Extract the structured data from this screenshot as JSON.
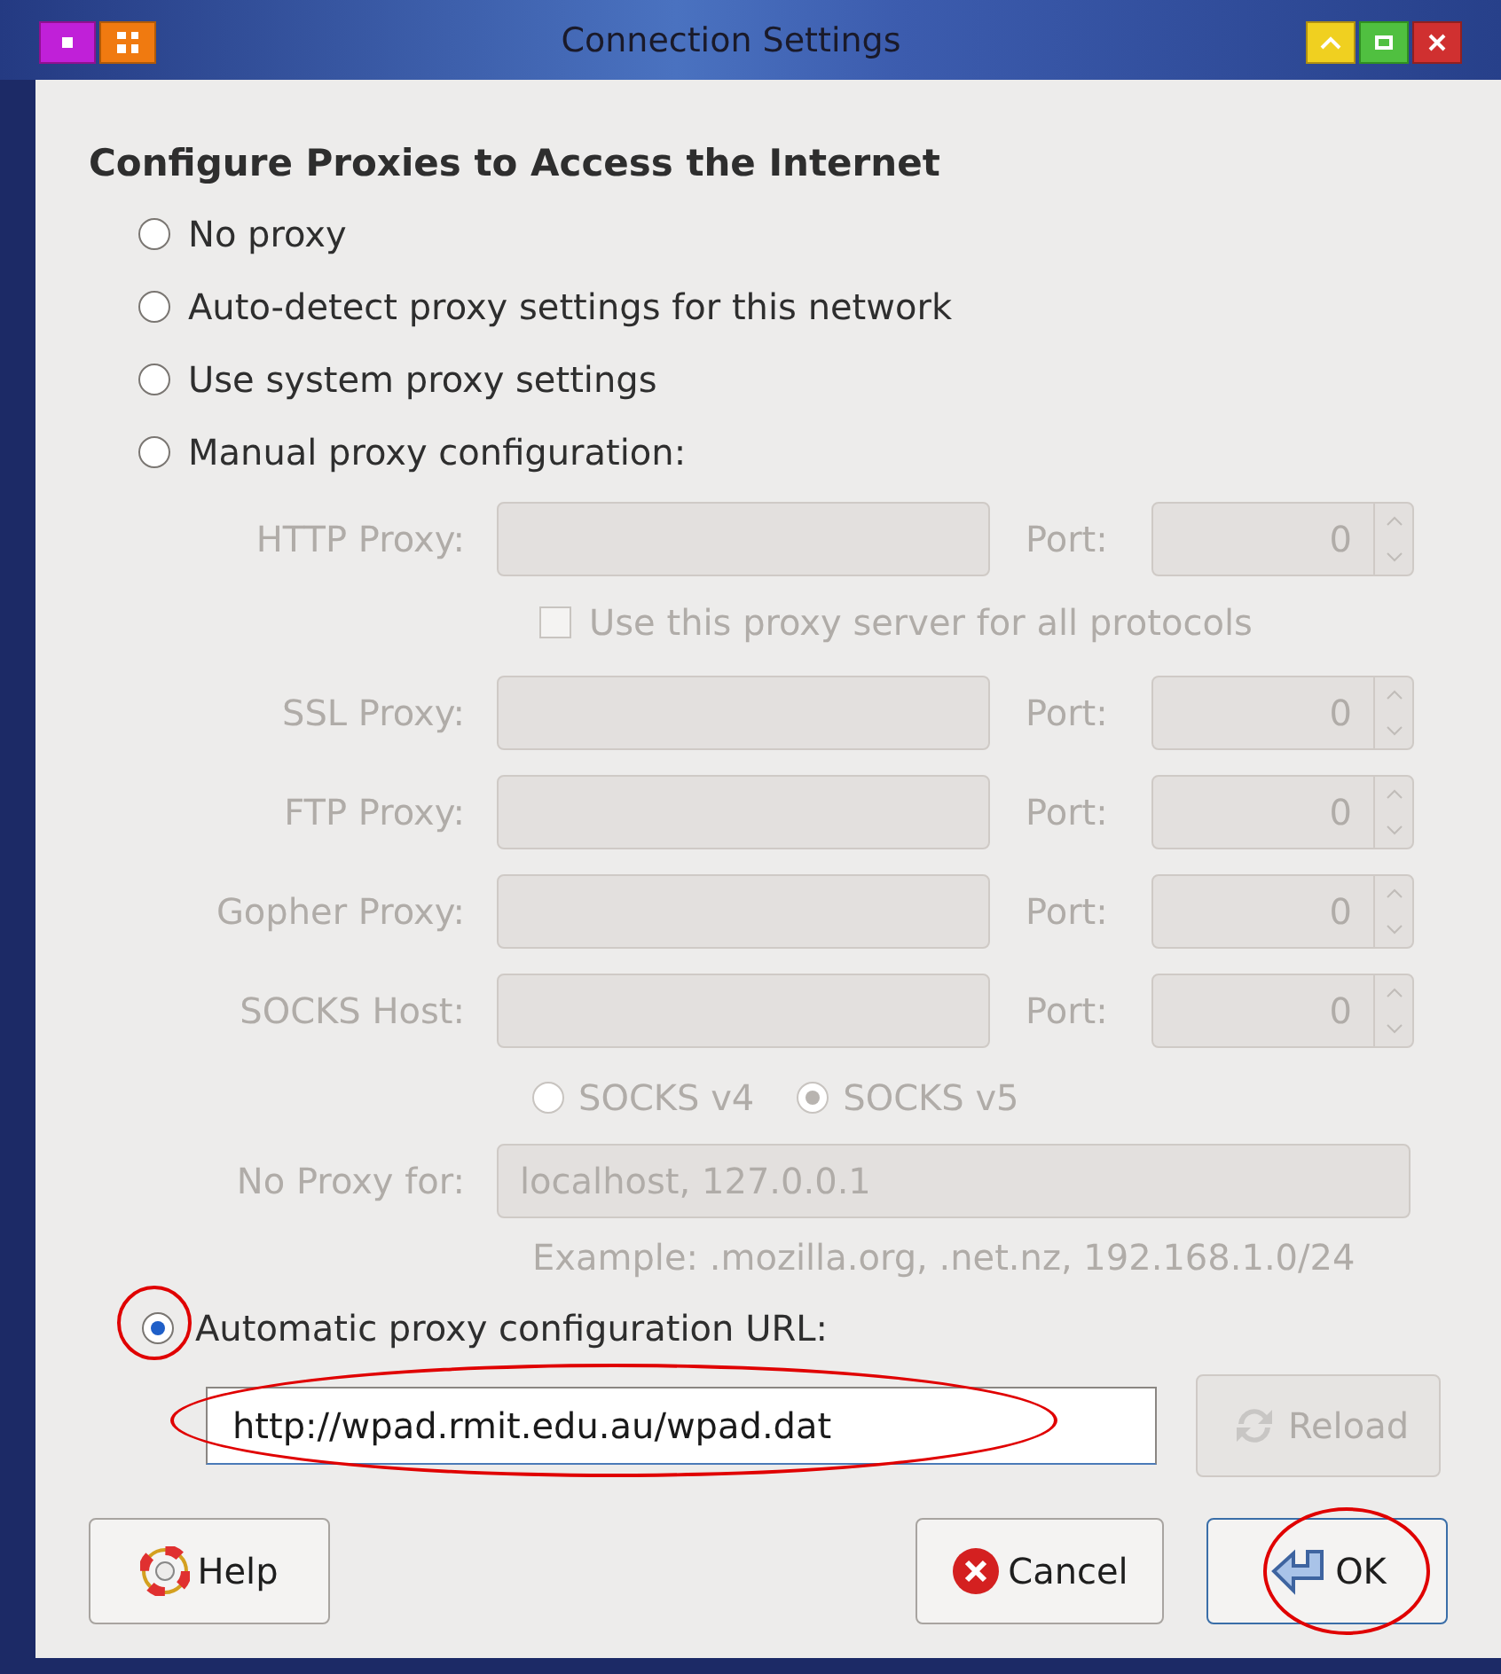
{
  "window": {
    "title": "Connection Settings"
  },
  "heading": "Configure Proxies to Access the Internet",
  "modes": [
    {
      "label": "No proxy",
      "selected": false
    },
    {
      "label": "Auto-detect proxy settings for this network",
      "selected": false
    },
    {
      "label": "Use system proxy settings",
      "selected": false
    },
    {
      "label": "Manual proxy configuration:",
      "selected": false
    }
  ],
  "manual": {
    "disabled": true,
    "proxies": [
      {
        "label": "HTTP Proxy:",
        "port_label": "Port:",
        "port": "0"
      },
      {
        "label": "SSL Proxy:",
        "port_label": "Port:",
        "port": "0"
      },
      {
        "label": "FTP Proxy:",
        "port_label": "Port:",
        "port": "0"
      },
      {
        "label": "Gopher Proxy:",
        "port_label": "Port:",
        "port": "0"
      },
      {
        "label": "SOCKS Host:",
        "port_label": "Port:",
        "port": "0"
      }
    ],
    "all_protocols": {
      "label": "Use this proxy server for all protocols",
      "checked": false
    },
    "socks_versions": [
      {
        "label": "SOCKS v4",
        "selected": false
      },
      {
        "label": "SOCKS v5",
        "selected": true
      }
    ],
    "no_proxy": {
      "label": "No Proxy for:",
      "value": "localhost, 127.0.0.1"
    },
    "example": "Example: .mozilla.org, .net.nz, 192.168.1.0/24"
  },
  "auto": {
    "label": "Automatic proxy configuration URL:",
    "selected": true,
    "value": "http://wpad.rmit.edu.au/wpad.dat",
    "reload": {
      "label": "Reload",
      "disabled": true
    }
  },
  "buttons": [
    {
      "kind": "help",
      "label": "Help"
    },
    {
      "kind": "cancel",
      "label": "Cancel"
    },
    {
      "kind": "ok",
      "label": "OK"
    }
  ]
}
